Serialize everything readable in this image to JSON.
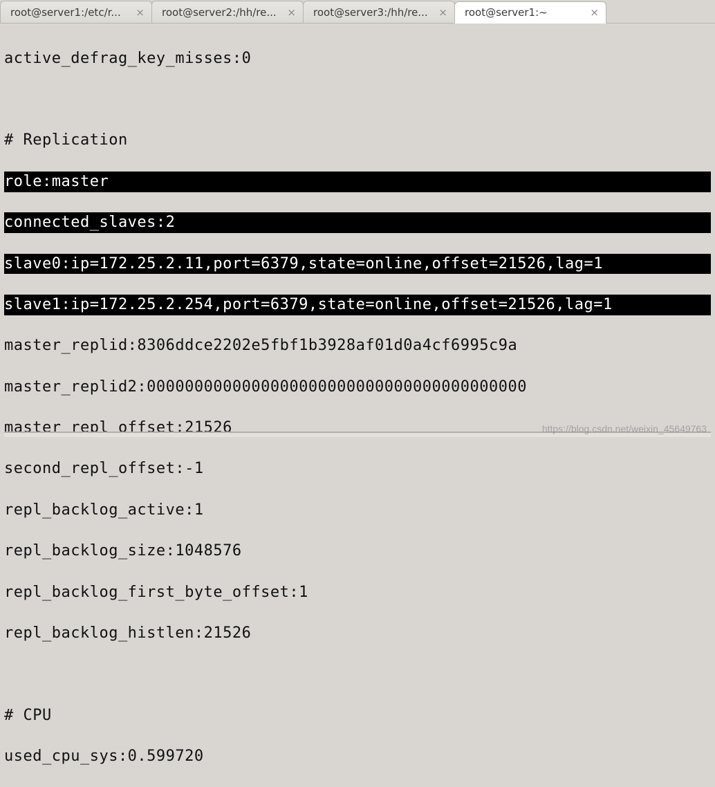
{
  "tabs": [
    {
      "label": "root@server1:/etc/r...",
      "active": false
    },
    {
      "label": "root@server2:/hh/re...",
      "active": false
    },
    {
      "label": "root@server3:/hh/re...",
      "active": false
    },
    {
      "label": "root@server1:~",
      "active": true
    }
  ],
  "close_glyph": "×",
  "terminal": {
    "line_defrag": "active_defrag_key_misses:0",
    "section_replication": "# Replication",
    "hl_role": "role:master",
    "hl_connected": "connected_slaves:2",
    "hl_slave0": "slave0:ip=172.25.2.11,port=6379,state=online,offset=21526,lag=1",
    "hl_slave1": "slave1:ip=172.25.2.254,port=6379,state=online,offset=21526,lag=1",
    "master_replid": "master_replid:8306ddce2202e5fbf1b3928af01d0a4cf6995c9a",
    "master_replid2": "master_replid2:0000000000000000000000000000000000000000",
    "master_repl_offset": "master_repl_offset:21526",
    "second_repl_offset": "second_repl_offset:-1",
    "repl_backlog_active": "repl_backlog_active:1",
    "repl_backlog_size": "repl_backlog_size:1048576",
    "repl_backlog_first_byte_offset": "repl_backlog_first_byte_offset:1",
    "repl_backlog_histlen": "repl_backlog_histlen:21526",
    "section_cpu": "# CPU",
    "used_cpu_sys": "used_cpu_sys:0.599720"
  },
  "watermark": "https://blog.csdn.net/weixin_45649763"
}
